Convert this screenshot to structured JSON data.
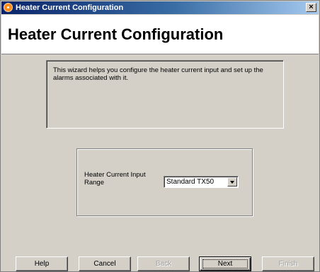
{
  "window": {
    "title": "Heater Current Configuration",
    "close_glyph": "×"
  },
  "header": {
    "title": "Heater Current Configuration"
  },
  "description": {
    "text": "This wizard helps you configure the heater current input and set up the alarms associated with it."
  },
  "range_group": {
    "label": "Heater Current Input Range",
    "select_value": "Standard TX50"
  },
  "buttons": {
    "help": "Help",
    "cancel": "Cancel",
    "back": "Back",
    "next": "Next",
    "finish": "Finish"
  },
  "colors": {
    "titlebar_start": "#0a246a",
    "titlebar_end": "#a6caf0",
    "face": "#d4d0c8"
  }
}
